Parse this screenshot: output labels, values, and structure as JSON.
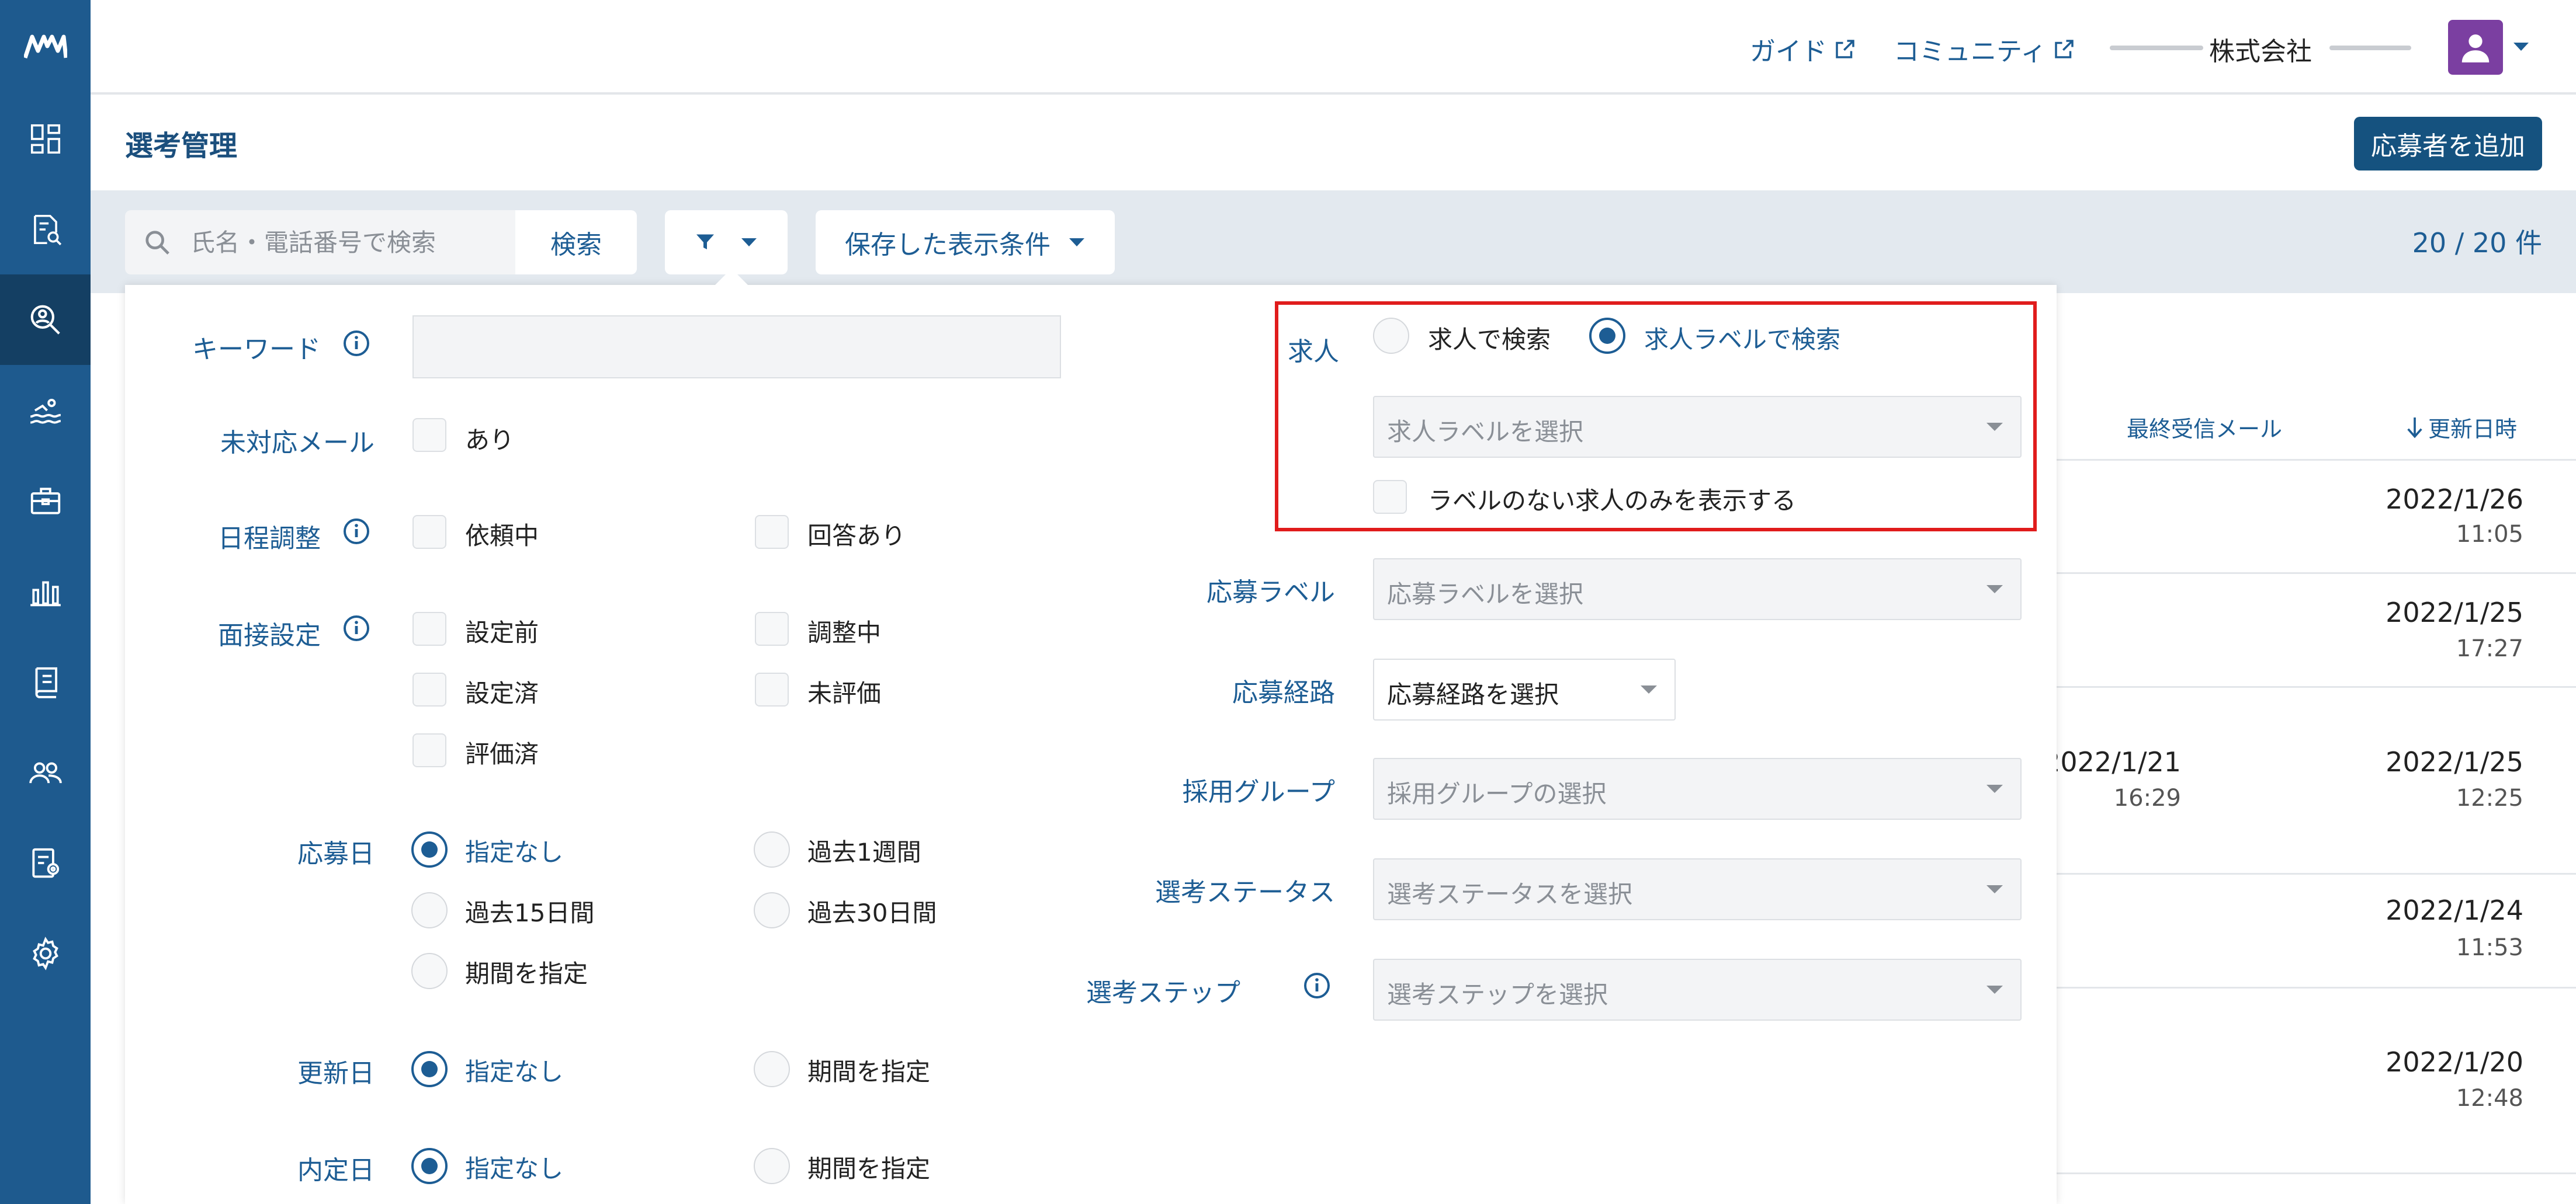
{
  "header": {
    "guide_label": "ガイド",
    "community_label": "コミュニティ",
    "company_label": "株式会社"
  },
  "page": {
    "title": "選考管理",
    "add_applicant_label": "応募者を追加"
  },
  "toolbar": {
    "search_placeholder": "氏名・電話番号で検索",
    "search_label": "検索",
    "saved_conditions_label": "保存した表示条件",
    "count": "20 / 20 件"
  },
  "table": {
    "headers": {
      "last_received_mail": "最終受信メール",
      "updated_at": "更新日時"
    },
    "rows": [
      {
        "mail_date": "",
        "mail_time": "",
        "updated_date": "2022/1/26",
        "updated_time": "11:05"
      },
      {
        "mail_date": "",
        "mail_time": "",
        "updated_date": "2022/1/25",
        "updated_time": "17:27"
      },
      {
        "mail_date": "2022/1/21",
        "mail_time": "16:29",
        "updated_date": "2022/1/25",
        "updated_time": "12:25"
      },
      {
        "mail_date": "",
        "mail_time": "",
        "updated_date": "2022/1/24",
        "updated_time": "11:53"
      },
      {
        "mail_date": "",
        "mail_time": "",
        "updated_date": "2022/1/20",
        "updated_time": "12:48"
      }
    ]
  },
  "filter": {
    "keyword": {
      "label": "キーワード",
      "value": ""
    },
    "unhandled_mail": {
      "label": "未対応メール",
      "options": [
        "あり"
      ]
    },
    "schedule": {
      "label": "日程調整",
      "options": [
        "依頼中",
        "回答あり"
      ]
    },
    "interview": {
      "label": "面接設定",
      "options": [
        "設定前",
        "調整中",
        "設定済",
        "未評価",
        "評価済"
      ]
    },
    "applied_date": {
      "label": "応募日",
      "options": [
        "指定なし",
        "過去1週間",
        "過去15日間",
        "過去30日間",
        "期間を指定"
      ],
      "selected": "指定なし"
    },
    "updated_date": {
      "label": "更新日",
      "options": [
        "指定なし",
        "期間を指定"
      ],
      "selected": "指定なし"
    },
    "offer_date": {
      "label": "内定日",
      "options": [
        "指定なし",
        "期間を指定"
      ],
      "selected": "指定なし"
    },
    "job": {
      "label": "求人",
      "options": [
        "求人で検索",
        "求人ラベルで検索"
      ],
      "selected": "求人ラベルで検索",
      "label_select_placeholder": "求人ラベルを選択",
      "no_label_only": "ラベルのない求人のみを表示する"
    },
    "application_label": {
      "label": "応募ラベル",
      "placeholder": "応募ラベルを選択"
    },
    "application_route": {
      "label": "応募経路",
      "placeholder": "応募経路を選択"
    },
    "hiring_group": {
      "label": "採用グループ",
      "placeholder": "採用グループの選択"
    },
    "selection_status": {
      "label": "選考ステータス",
      "placeholder": "選考ステータスを選択"
    },
    "selection_step": {
      "label": "選考ステップ",
      "placeholder": "選考ステップを選択"
    }
  },
  "colors": {
    "primary": "#1d5d94",
    "sidebar": "#1e5a8e",
    "highlight": "#e01c1c",
    "avatar": "#7b3fa1"
  }
}
